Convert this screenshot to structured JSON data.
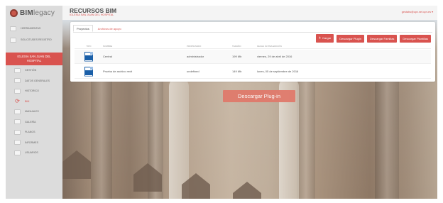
{
  "app": {
    "logo_bold": "BIM",
    "logo_light": "legacy"
  },
  "sidebar": {
    "top_items": [
      {
        "label": "Herramientas",
        "icon": "tools-icon"
      },
      {
        "label": "Solicitudes registro",
        "icon": "mail-icon"
      }
    ],
    "project": {
      "label_line1": "Iglesia San Juan del",
      "label_line2": "Hospital"
    },
    "sub_items": [
      {
        "label": "Gestión",
        "icon": "settings-icon"
      },
      {
        "label": "Datos generales",
        "icon": "data-icon"
      },
      {
        "label": "Historico",
        "icon": "history-icon"
      },
      {
        "label": "BIM",
        "icon": "sync-icon",
        "active": true
      },
      {
        "label": "Manuales",
        "icon": "book-icon"
      },
      {
        "label": "Galería",
        "icon": "gallery-icon"
      },
      {
        "label": "Planos",
        "icon": "plans-icon"
      },
      {
        "label": "Informes",
        "icon": "report-icon"
      },
      {
        "label": "Usuarios",
        "icon": "users-icon"
      }
    ]
  },
  "header": {
    "title": "RECURSOS BIM",
    "subtitle": "Iglesia San Juan del Hospital",
    "user_email": "gestabs@upv.net.upv.es ▾"
  },
  "panel": {
    "tabs": [
      {
        "label": "Proyectos",
        "active": true
      },
      {
        "label": "Archivos de apoyo",
        "active": false
      }
    ],
    "actions": {
      "add_label": "Cargar",
      "download_revit": "Descargar Plugin",
      "download_families": "Descargar Familias",
      "download_templates": "Descargar Plantillas"
    },
    "columns": [
      "Tipo",
      "Nombre",
      "Propietario",
      "Tamaño",
      "Fecha última edición"
    ],
    "rows": [
      {
        "type_icon": "revit-file-icon",
        "name": "Central",
        "owner": "administrador",
        "size": "199 Mb",
        "date": "viernes, 29 de abril de 2016"
      },
      {
        "type_icon": "revit-file-icon",
        "name": "Prueba de archivo revit",
        "owner": "undefined",
        "size": "149 Mb",
        "date": "lunes, 05 de septiembre de 2016"
      }
    ]
  },
  "cta": {
    "label": "Descargar Plug-in"
  },
  "colors": {
    "accent": "#d9534f",
    "sidebar": "#dcdcdc",
    "file_icon": "#1a5fa8"
  }
}
